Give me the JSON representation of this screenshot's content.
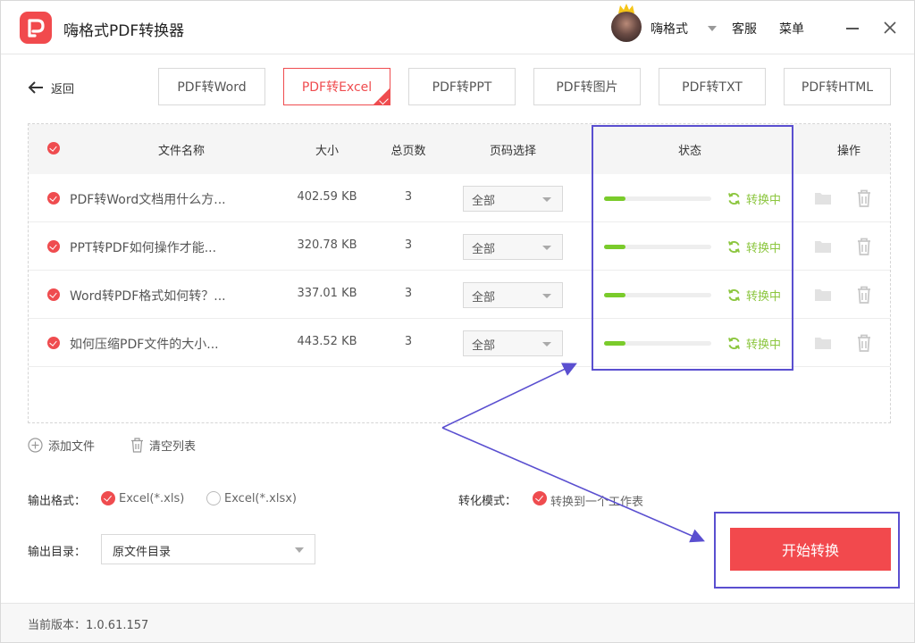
{
  "app": {
    "title": "嗨格式PDF转换器"
  },
  "header": {
    "user_name": "嗨格式",
    "service_label": "客服",
    "menu_label": "菜单"
  },
  "toolbar": {
    "back_label": "返回",
    "tabs": [
      {
        "label": "PDF转Word",
        "active": false
      },
      {
        "label": "PDF转Excel",
        "active": true
      },
      {
        "label": "PDF转PPT",
        "active": false
      },
      {
        "label": "PDF转图片",
        "active": false
      },
      {
        "label": "PDF转TXT",
        "active": false
      },
      {
        "label": "PDF转HTML",
        "active": false
      }
    ]
  },
  "table": {
    "columns": {
      "name": "文件名称",
      "size": "大小",
      "pages": "总页数",
      "page_select": "页码选择",
      "status": "状态",
      "actions": "操作"
    },
    "rows": [
      {
        "name": "PDF转Word文档用什么方...",
        "size": "402.59 KB",
        "pages": "3",
        "page_select": "全部",
        "progress": 0.2,
        "status": "转换中"
      },
      {
        "name": "PPT转PDF如何操作才能...",
        "size": "320.78 KB",
        "pages": "3",
        "page_select": "全部",
        "progress": 0.2,
        "status": "转换中"
      },
      {
        "name": "Word转PDF格式如何转？...",
        "size": "337.01 KB",
        "pages": "3",
        "page_select": "全部",
        "progress": 0.2,
        "status": "转换中"
      },
      {
        "name": "如何压缩PDF文件的大小...",
        "size": "443.52 KB",
        "pages": "3",
        "page_select": "全部",
        "progress": 0.2,
        "status": "转换中"
      }
    ]
  },
  "list_actions": {
    "add_file": "添加文件",
    "clear_list": "清空列表"
  },
  "options": {
    "output_format_label": "输出格式：",
    "format_xls": "Excel(*.xls)",
    "format_xlsx": "Excel(*.xlsx)",
    "selected_format": "xls",
    "convert_mode_label": "转化模式：",
    "convert_mode_value": "转换到一个工作表",
    "output_dir_label": "输出目录：",
    "output_dir_value": "原文件目录"
  },
  "start_button": "开始转换",
  "footer": {
    "version": "当前版本：1.0.61.157"
  },
  "colors": {
    "accent": "#ef4c4f",
    "progress": "#7acb2b",
    "status_text": "#8cc63f",
    "annotation": "#5a4fd0"
  },
  "icons": {
    "logo": "app-logo-icon",
    "back": "arrow-left-icon",
    "minimize": "minimize-icon",
    "close": "close-icon",
    "status": "refresh-icon",
    "folder": "folder-icon",
    "delete": "trash-icon",
    "add": "plus-circle-icon",
    "clear": "trash-icon"
  }
}
